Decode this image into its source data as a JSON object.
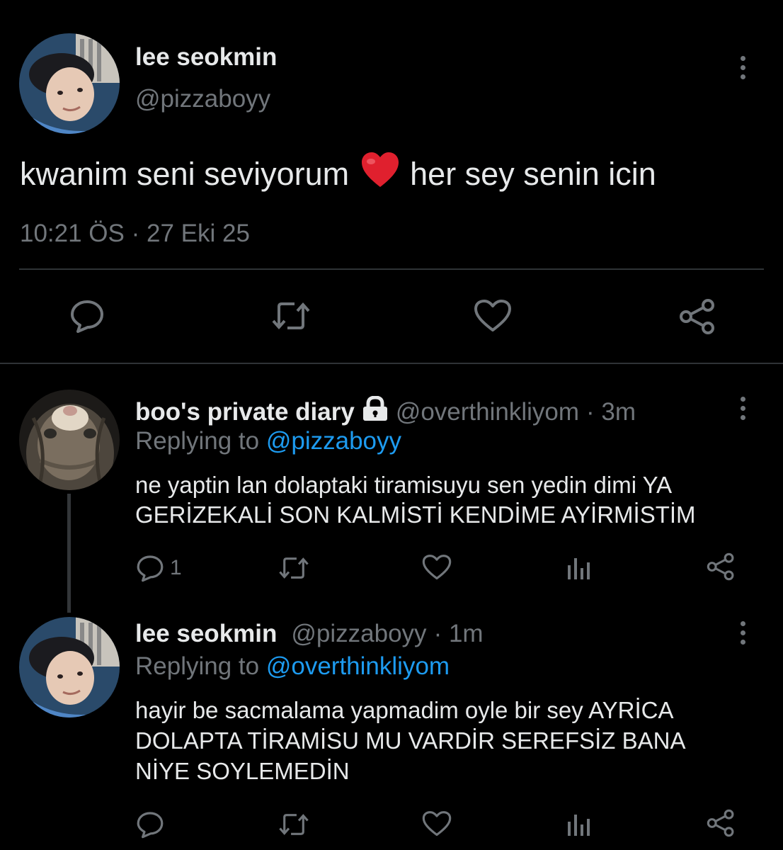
{
  "main_tweet": {
    "display_name": "lee seokmin",
    "handle": "@pizzaboyy",
    "text_before_emoji": "kwanim seni seviyorum",
    "text_after_emoji": "her sey senin icin",
    "timestamp": "10:21 ÖS · 27 Eki 25"
  },
  "reply1": {
    "display_name": "boo's private diary",
    "handle": "@overthinkliyom",
    "time": "· 3m",
    "replying_prefix": "Replying to",
    "replying_to": "@pizzaboyy",
    "text_line1": "ne yaptin lan dolaptaki tiramisuyu sen yedin dimi YA",
    "text_line2": "GERİZEKALİ SON KALMİSTİ KENDİME AYİRMİSTİM",
    "reply_count": "1"
  },
  "reply2": {
    "display_name": "lee seokmin",
    "handle": "@pizzaboyy",
    "time": "· 1m",
    "replying_prefix": "Replying to",
    "replying_to": "@overthinkliyom",
    "text_line1": "hayir be sacmalama yapmadim oyle bir sey AYRİCA",
    "text_line2": "DOLAPTA TİRAMİSU MU VARDİR SEREFSİZ BANA",
    "text_line3": "NİYE SOYLEMEDİN"
  },
  "icons": {
    "reply": "reply-icon",
    "retweet": "retweet-icon",
    "like": "heart-icon",
    "share": "share-icon",
    "views": "analytics-icon",
    "more": "more-icon",
    "lock": "lock-icon",
    "heart_emoji": "red-heart-emoji"
  },
  "colors": {
    "background": "#000000",
    "text": "#e7e9ea",
    "muted": "#71767b",
    "link": "#1d9bf0",
    "heart": "#e0202e",
    "divider": "#2f3336"
  }
}
